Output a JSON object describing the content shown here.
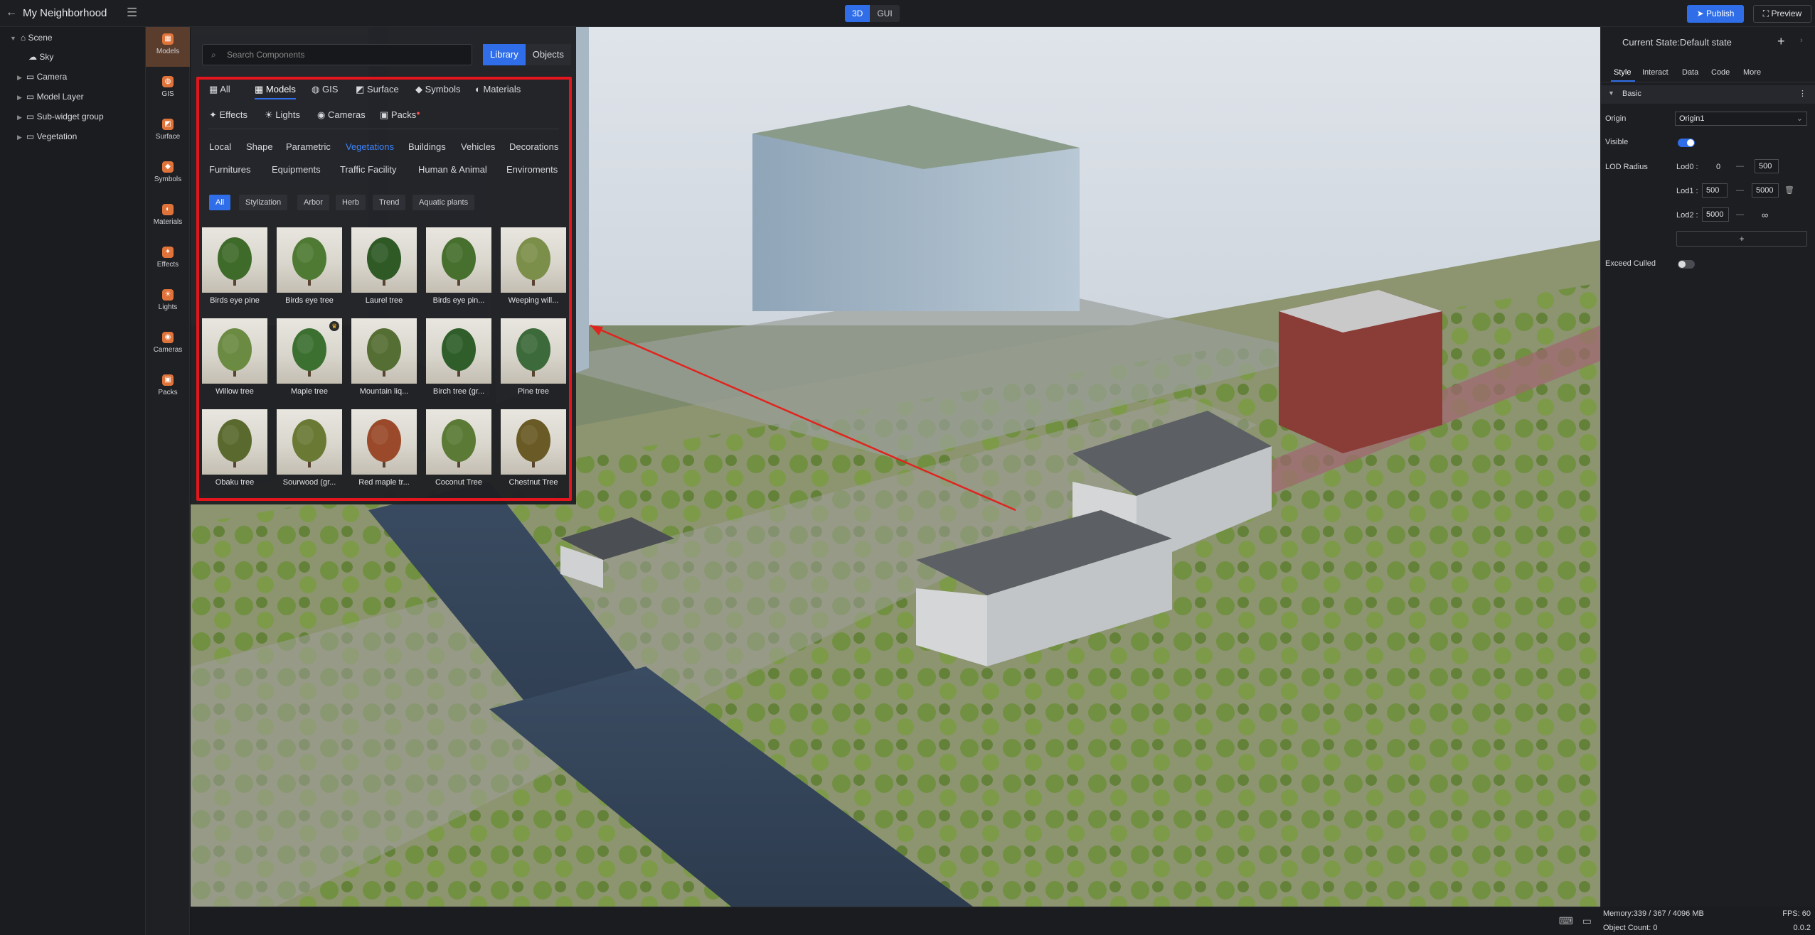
{
  "header": {
    "app_name": "My Neighborhood",
    "mode_3d": "3D",
    "mode_gui": "GUI",
    "publish": "Publish",
    "preview": "Preview"
  },
  "scene_tree": {
    "root": "Scene",
    "items": [
      "Sky",
      "Camera",
      "Model Layer",
      "Sub-widget group",
      "Vegetation"
    ]
  },
  "rail": {
    "items": [
      "Models",
      "GIS",
      "Surface",
      "Symbols",
      "Materials",
      "Effects",
      "Lights",
      "Cameras",
      "Packs"
    ]
  },
  "library": {
    "search_placeholder": "Search Components",
    "library_tab": "Library",
    "objects_tab": "Objects",
    "categories": [
      "All",
      "Models",
      "GIS",
      "Surface",
      "Symbols",
      "Materials",
      "Effects",
      "Lights",
      "Cameras",
      "Packs"
    ],
    "subcategories": [
      "Local",
      "Shape",
      "Parametric",
      "Vegetations",
      "Buildings",
      "Vehicles",
      "Decorations",
      "Furnitures",
      "Equipments",
      "Traffic Facility",
      "Human & Animal",
      "Enviroments"
    ],
    "filters": [
      "All",
      "Stylization",
      "Arbor",
      "Herb",
      "Trend",
      "Aquatic plants"
    ],
    "items": [
      "Birds eye pine",
      "Birds eye tree",
      "Laurel tree",
      "Birds eye pin...",
      "Weeping will...",
      "Willow tree",
      "Maple tree",
      "Mountain liq...",
      "Birch tree (gr...",
      "Pine tree",
      "Obaku tree",
      "Sourwood (gr...",
      "Red maple tr...",
      "Coconut Tree",
      "Chestnut Tree"
    ]
  },
  "inspector": {
    "state": "Current State:Default state",
    "tabs": [
      "Style",
      "Interact",
      "Data",
      "Code",
      "More"
    ],
    "section": "Basic",
    "origin_label": "Origin",
    "origin_value": "Origin1",
    "visible_label": "Visible",
    "lod_label": "LOD Radius",
    "lod0": "Lod0 :",
    "lod0_min": "0",
    "lod0_max": "500",
    "lod1": "Lod1 :",
    "lod1_min": "500",
    "lod1_max": "5000",
    "lod2": "Lod2 :",
    "lod2_min": "5000",
    "lod2_max": "∞",
    "dash": "—",
    "add": "+",
    "exceed_label": "Exceed Culled"
  },
  "status": {
    "memory": "Memory:339 / 367 / 4096 MB",
    "fps": "FPS: 60",
    "objects": "Object Count: 0",
    "version": "0.0.2"
  }
}
